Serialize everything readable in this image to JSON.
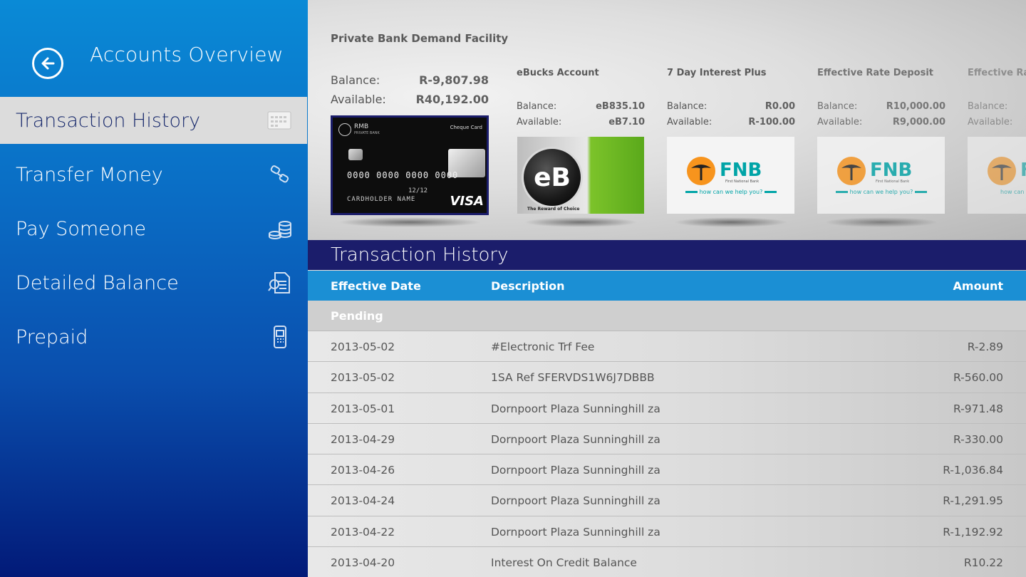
{
  "sidebar": {
    "title": "Accounts Overview",
    "items": [
      {
        "label": "Transaction History",
        "icon": "calendar-icon"
      },
      {
        "label": "Transfer Money",
        "icon": "transfer-icon"
      },
      {
        "label": "Pay Someone",
        "icon": "coins-icon"
      },
      {
        "label": "Detailed Balance",
        "icon": "document-search-icon"
      },
      {
        "label": "Prepaid",
        "icon": "mobile-phone-icon"
      }
    ]
  },
  "accounts": [
    {
      "name": "Private Bank Demand Facility",
      "balance_label": "Balance:",
      "balance": "R-9,807.98",
      "available_label": "Available:",
      "available": "R40,192.00",
      "card": {
        "brand": "RMB",
        "brand_sub": "PRIVATE BANK",
        "type": "Cheque Card",
        "number": "0000  0000  0000  0000",
        "expiry": "12/12",
        "holder": "CARDHOLDER NAME",
        "network": "VISA"
      }
    },
    {
      "name": "eBucks Account",
      "balance_label": "Balance:",
      "balance": "eB835.10",
      "available_label": "Available:",
      "available": "eB7.10",
      "card": {
        "logo": "eB",
        "tagline": "The Reward of Choice"
      }
    },
    {
      "name": "7 Day Interest Plus",
      "balance_label": "Balance:",
      "balance": "R0.00",
      "available_label": "Available:",
      "available": "R-100.00",
      "card": {
        "logo": "FNB",
        "sub": "First National Bank",
        "tagline": "how can we help you?"
      }
    },
    {
      "name": "Effective Rate Deposit",
      "balance_label": "Balance:",
      "balance": "R10,000.00",
      "available_label": "Available:",
      "available": "R9,000.00",
      "card": {
        "logo": "FNB",
        "sub": "First National Bank",
        "tagline": "how can we help you?"
      }
    },
    {
      "name": "Effective Rate",
      "balance_label": "Balance:",
      "available_label": "Available:",
      "card": {
        "logo": "FNB",
        "tagline": "how can"
      }
    }
  ],
  "transactions": {
    "title": "Transaction History",
    "columns": {
      "date": "Effective Date",
      "description": "Description",
      "amount": "Amount"
    },
    "pending_label": "Pending",
    "rows": [
      {
        "date": "2013-05-02",
        "description": "#Electronic Trf Fee",
        "amount": "R-2.89"
      },
      {
        "date": "2013-05-02",
        "description": "1SA Ref SFERVDS1W6J7DBBB",
        "amount": "R-560.00"
      },
      {
        "date": "2013-05-01",
        "description": "Dornpoort Plaza Sunninghill  za",
        "amount": "R-971.48"
      },
      {
        "date": "2013-04-29",
        "description": "Dornpoort Plaza Sunninghill  za",
        "amount": "R-330.00"
      },
      {
        "date": "2013-04-26",
        "description": "Dornpoort Plaza Sunninghill  za",
        "amount": "R-1,036.84"
      },
      {
        "date": "2013-04-24",
        "description": "Dornpoort Plaza Sunninghill  za",
        "amount": "R-1,291.95"
      },
      {
        "date": "2013-04-22",
        "description": "Dornpoort Plaza Sunninghill  za",
        "amount": "R-1,192.92"
      },
      {
        "date": "2013-04-20",
        "description": "Interest On Credit Balance",
        "amount": "R10.22"
      }
    ]
  },
  "colors": {
    "sidebar_top": "#0a8ad6",
    "sidebar_bottom": "#021a78",
    "title_bar": "#1b1d6b",
    "header_bar": "#1b8fd4",
    "fnb_teal": "#00a4a7",
    "fnb_orange": "#f7941d"
  }
}
